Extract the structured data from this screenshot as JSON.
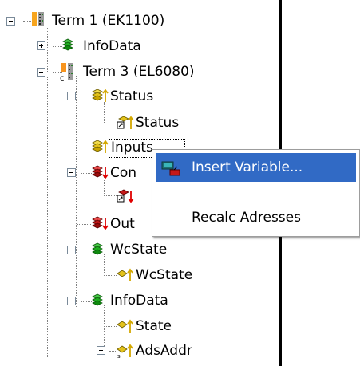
{
  "tree": {
    "items": [
      {
        "label": "Term 1 (EK1100)"
      },
      {
        "label": "InfoData"
      },
      {
        "label": "Term 3 (EL6080)"
      },
      {
        "label": "Status"
      },
      {
        "label": "Status"
      },
      {
        "label": "Inputs"
      },
      {
        "label": "Con"
      },
      {
        "label": "Out"
      },
      {
        "label": "WcState"
      },
      {
        "label": "WcState"
      },
      {
        "label": "InfoData"
      },
      {
        "label": "State"
      },
      {
        "label": "AdsAddr"
      }
    ]
  },
  "context_menu": {
    "items": [
      {
        "label": "Insert Variable..."
      },
      {
        "label": "Recalc Adresses"
      }
    ]
  },
  "colors": {
    "selection": "#316ac5",
    "arrow_up": "#d4a800",
    "arrow_down": "#e00000",
    "icon_green": "#1fae1f",
    "icon_yellow": "#e3c21a",
    "icon_red": "#c41818"
  },
  "icons": [
    "tree-expander",
    "terminal-icon",
    "variable-group-icon",
    "variable-icon",
    "insert-variable-icon"
  ]
}
